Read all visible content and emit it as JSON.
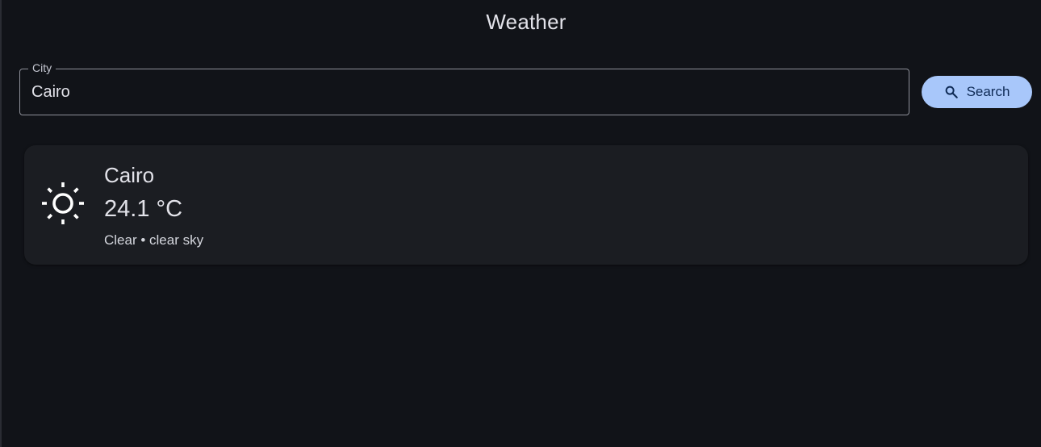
{
  "app": {
    "title": "Weather"
  },
  "search": {
    "label": "City",
    "value": "Cairo",
    "button_label": "Search",
    "button_icon": "search-icon"
  },
  "result": {
    "city": "Cairo",
    "temperature": "24.1 °C",
    "description": "Clear • clear sky",
    "icon": "sun-icon"
  },
  "colors": {
    "background": "#111318",
    "card": "#1b1d22",
    "accent": "#a8c7fa",
    "text": "#e2e2e9"
  }
}
